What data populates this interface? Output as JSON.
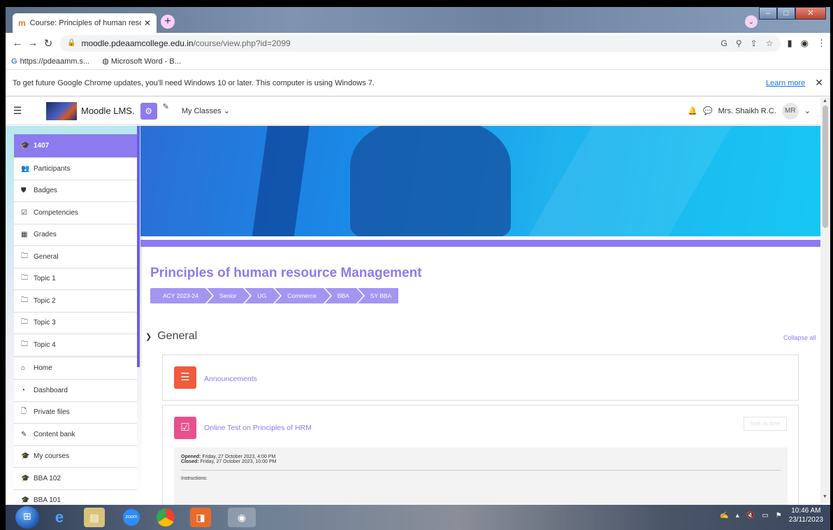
{
  "browser": {
    "tab_title": "Course: Principles of human reso",
    "tab_favicon": "m",
    "url_host": "moodle.pdeaamcollege.edu.in",
    "url_path": "/course/view.php?id=2099",
    "bookmarks": [
      "https://pdeaamm.s...",
      "Microsoft Word - B..."
    ],
    "infobar_text": "To get future Google Chrome updates, you'll need Windows 10 or later. This computer is using Windows 7.",
    "infobar_link": "Learn more"
  },
  "moodle_nav": {
    "brand": "Moodle LMS.",
    "my_classes": "My Classes",
    "user_name": "Mrs. Shaikh R.C.",
    "avatar_initials": "MR"
  },
  "drawer": {
    "items": [
      {
        "label": "1407",
        "icon": "graduation-cap-icon",
        "glyph": "🎓"
      },
      {
        "label": "Participants",
        "icon": "users-icon",
        "glyph": "👥"
      },
      {
        "label": "Badges",
        "icon": "shield-icon",
        "glyph": "⛊"
      },
      {
        "label": "Competencies",
        "icon": "checkbox-icon",
        "glyph": "☑"
      },
      {
        "label": "Grades",
        "icon": "table-icon",
        "glyph": "▦"
      },
      {
        "label": "General",
        "icon": "folder-icon",
        "glyph": "🗀"
      },
      {
        "label": "Topic 1",
        "icon": "folder-icon",
        "glyph": "🗀"
      },
      {
        "label": "Topic 2",
        "icon": "folder-icon",
        "glyph": "🗀"
      },
      {
        "label": "Topic 3",
        "icon": "folder-icon",
        "glyph": "🗀"
      },
      {
        "label": "Topic 4",
        "icon": "folder-icon",
        "glyph": "🗀"
      },
      {
        "label": "Home",
        "icon": "home-icon",
        "glyph": "⌂"
      },
      {
        "label": "Dashboard",
        "icon": "dashboard-icon",
        "glyph": "◔"
      },
      {
        "label": "Private files",
        "icon": "file-icon",
        "glyph": "🗋"
      },
      {
        "label": "Content bank",
        "icon": "paint-brush-icon",
        "glyph": "✎"
      },
      {
        "label": "My courses",
        "icon": "graduation-cap-icon",
        "glyph": "🎓"
      },
      {
        "label": "BBA 102",
        "icon": "graduation-cap-icon",
        "glyph": "🎓"
      },
      {
        "label": "BBA 101",
        "icon": "graduation-cap-icon",
        "glyph": "🎓"
      }
    ]
  },
  "course": {
    "title": "Principles of human resource Management",
    "breadcrumbs": [
      "ACY 2023-24",
      "Senior",
      "UG",
      "Commerce",
      "BBA",
      "SY BBA"
    ]
  },
  "section": {
    "title": "General",
    "collapse_all": "Collapse all"
  },
  "activities": {
    "announcements": "Announcements",
    "quiz_title": "Online Test on Principles of HRM",
    "mark_done": "Mark as done",
    "opened_label": "Opened:",
    "opened_value": "Friday, 27 October 2023, 4:00 PM",
    "closed_label": "Closed:",
    "closed_value": "Friday, 27 October 2023, 10:00 PM",
    "instructions": "Instructions:"
  },
  "taskbar": {
    "time": "10:46 AM",
    "date": "23/11/2023"
  },
  "colors": {
    "accent": "#8b7bef",
    "banner": "#1a88e6"
  }
}
